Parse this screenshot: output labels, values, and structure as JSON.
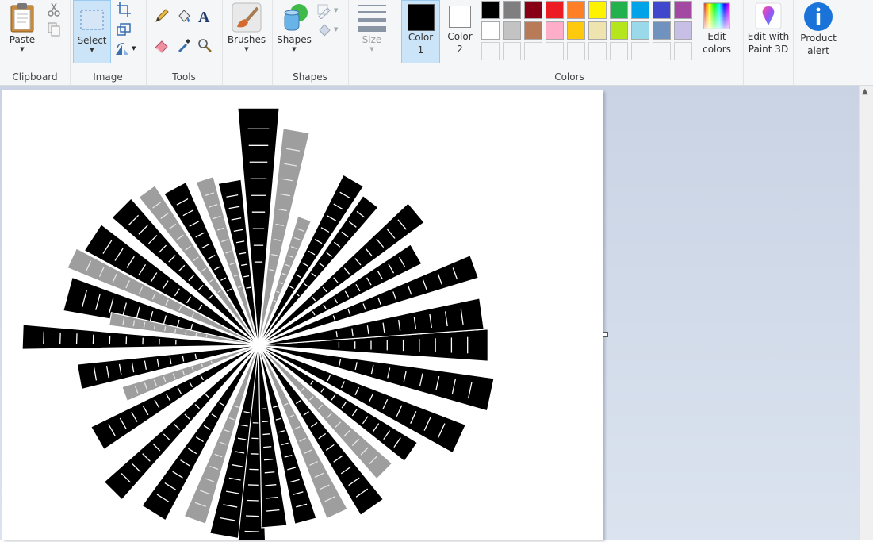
{
  "ribbon": {
    "clipboard": {
      "group_label": "Clipboard",
      "paste_label": "Paste"
    },
    "image": {
      "group_label": "Image",
      "select_label": "Select"
    },
    "tools": {
      "group_label": "Tools"
    },
    "brushes": {
      "label": "Brushes"
    },
    "shapes": {
      "group_label": "Shapes",
      "label": "Shapes"
    },
    "size": {
      "label": "Size"
    },
    "colors": {
      "group_label": "Colors",
      "color1_label": "Color\n1",
      "color2_label": "Color\n2",
      "edit_colors_label": "Edit\ncolors",
      "color1": "#000000",
      "color2": "#ffffff",
      "palette_row1": [
        "#000000",
        "#7f7f7f",
        "#880015",
        "#ed1c24",
        "#ff7f27",
        "#fff200",
        "#22b14c",
        "#00a2e8",
        "#3f48cc",
        "#a349a4"
      ],
      "palette_row2": [
        "#ffffff",
        "#c3c3c3",
        "#b97a57",
        "#ffaec9",
        "#ffc90e",
        "#efe4b0",
        "#b5e61d",
        "#99d9ea",
        "#7092be",
        "#c8bfe7"
      ]
    },
    "paint3d": {
      "label": "Edit with\nPaint 3D"
    },
    "product_alert": {
      "label": "Product\nalert"
    }
  },
  "canvas": {
    "image_subject": "skyline-burst-artwork"
  }
}
